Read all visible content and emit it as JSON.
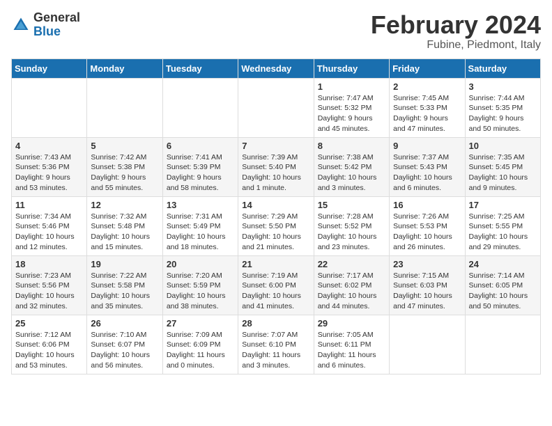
{
  "header": {
    "logo_general": "General",
    "logo_blue": "Blue",
    "title": "February 2024",
    "subtitle": "Fubine, Piedmont, Italy"
  },
  "days_of_week": [
    "Sunday",
    "Monday",
    "Tuesday",
    "Wednesday",
    "Thursday",
    "Friday",
    "Saturday"
  ],
  "weeks": [
    [
      {
        "day": "",
        "info": ""
      },
      {
        "day": "",
        "info": ""
      },
      {
        "day": "",
        "info": ""
      },
      {
        "day": "",
        "info": ""
      },
      {
        "day": "1",
        "info": "Sunrise: 7:47 AM\nSunset: 5:32 PM\nDaylight: 9 hours\nand 45 minutes."
      },
      {
        "day": "2",
        "info": "Sunrise: 7:45 AM\nSunset: 5:33 PM\nDaylight: 9 hours\nand 47 minutes."
      },
      {
        "day": "3",
        "info": "Sunrise: 7:44 AM\nSunset: 5:35 PM\nDaylight: 9 hours\nand 50 minutes."
      }
    ],
    [
      {
        "day": "4",
        "info": "Sunrise: 7:43 AM\nSunset: 5:36 PM\nDaylight: 9 hours\nand 53 minutes."
      },
      {
        "day": "5",
        "info": "Sunrise: 7:42 AM\nSunset: 5:38 PM\nDaylight: 9 hours\nand 55 minutes."
      },
      {
        "day": "6",
        "info": "Sunrise: 7:41 AM\nSunset: 5:39 PM\nDaylight: 9 hours\nand 58 minutes."
      },
      {
        "day": "7",
        "info": "Sunrise: 7:39 AM\nSunset: 5:40 PM\nDaylight: 10 hours\nand 1 minute."
      },
      {
        "day": "8",
        "info": "Sunrise: 7:38 AM\nSunset: 5:42 PM\nDaylight: 10 hours\nand 3 minutes."
      },
      {
        "day": "9",
        "info": "Sunrise: 7:37 AM\nSunset: 5:43 PM\nDaylight: 10 hours\nand 6 minutes."
      },
      {
        "day": "10",
        "info": "Sunrise: 7:35 AM\nSunset: 5:45 PM\nDaylight: 10 hours\nand 9 minutes."
      }
    ],
    [
      {
        "day": "11",
        "info": "Sunrise: 7:34 AM\nSunset: 5:46 PM\nDaylight: 10 hours\nand 12 minutes."
      },
      {
        "day": "12",
        "info": "Sunrise: 7:32 AM\nSunset: 5:48 PM\nDaylight: 10 hours\nand 15 minutes."
      },
      {
        "day": "13",
        "info": "Sunrise: 7:31 AM\nSunset: 5:49 PM\nDaylight: 10 hours\nand 18 minutes."
      },
      {
        "day": "14",
        "info": "Sunrise: 7:29 AM\nSunset: 5:50 PM\nDaylight: 10 hours\nand 21 minutes."
      },
      {
        "day": "15",
        "info": "Sunrise: 7:28 AM\nSunset: 5:52 PM\nDaylight: 10 hours\nand 23 minutes."
      },
      {
        "day": "16",
        "info": "Sunrise: 7:26 AM\nSunset: 5:53 PM\nDaylight: 10 hours\nand 26 minutes."
      },
      {
        "day": "17",
        "info": "Sunrise: 7:25 AM\nSunset: 5:55 PM\nDaylight: 10 hours\nand 29 minutes."
      }
    ],
    [
      {
        "day": "18",
        "info": "Sunrise: 7:23 AM\nSunset: 5:56 PM\nDaylight: 10 hours\nand 32 minutes."
      },
      {
        "day": "19",
        "info": "Sunrise: 7:22 AM\nSunset: 5:58 PM\nDaylight: 10 hours\nand 35 minutes."
      },
      {
        "day": "20",
        "info": "Sunrise: 7:20 AM\nSunset: 5:59 PM\nDaylight: 10 hours\nand 38 minutes."
      },
      {
        "day": "21",
        "info": "Sunrise: 7:19 AM\nSunset: 6:00 PM\nDaylight: 10 hours\nand 41 minutes."
      },
      {
        "day": "22",
        "info": "Sunrise: 7:17 AM\nSunset: 6:02 PM\nDaylight: 10 hours\nand 44 minutes."
      },
      {
        "day": "23",
        "info": "Sunrise: 7:15 AM\nSunset: 6:03 PM\nDaylight: 10 hours\nand 47 minutes."
      },
      {
        "day": "24",
        "info": "Sunrise: 7:14 AM\nSunset: 6:05 PM\nDaylight: 10 hours\nand 50 minutes."
      }
    ],
    [
      {
        "day": "25",
        "info": "Sunrise: 7:12 AM\nSunset: 6:06 PM\nDaylight: 10 hours\nand 53 minutes."
      },
      {
        "day": "26",
        "info": "Sunrise: 7:10 AM\nSunset: 6:07 PM\nDaylight: 10 hours\nand 56 minutes."
      },
      {
        "day": "27",
        "info": "Sunrise: 7:09 AM\nSunset: 6:09 PM\nDaylight: 11 hours\nand 0 minutes."
      },
      {
        "day": "28",
        "info": "Sunrise: 7:07 AM\nSunset: 6:10 PM\nDaylight: 11 hours\nand 3 minutes."
      },
      {
        "day": "29",
        "info": "Sunrise: 7:05 AM\nSunset: 6:11 PM\nDaylight: 11 hours\nand 6 minutes."
      },
      {
        "day": "",
        "info": ""
      },
      {
        "day": "",
        "info": ""
      }
    ]
  ]
}
